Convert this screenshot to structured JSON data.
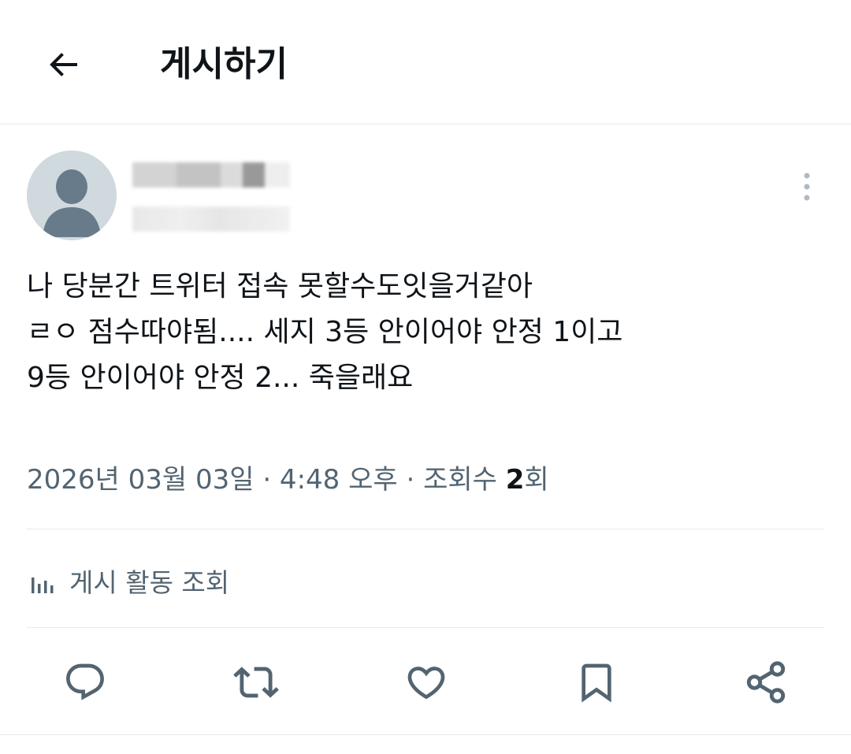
{
  "header": {
    "title": "게시하기",
    "back_icon": "back-arrow-icon"
  },
  "author": {
    "avatar_icon": "default-avatar-icon",
    "more_icon": "more-vertical-icon"
  },
  "tweet": {
    "lines": [
      "나 당분간 트위터 접속 못할수도잇을거같아",
      "ㄹㅇ 점수따야됨.... 세지 3등 안이어야 안정 1이고",
      "9등 안이어야 안정 2... 죽을래요"
    ]
  },
  "meta": {
    "datetime": "2026년 03월 03일 · 4:48 오후 · 조회수 ",
    "views": "2",
    "views_suffix": "회"
  },
  "activity": {
    "label": "게시 활동 조회",
    "icon": "analytics-bar-icon"
  },
  "actions": {
    "reply_icon": "reply-icon",
    "retweet_icon": "retweet-icon",
    "like_icon": "heart-icon",
    "bookmark_icon": "bookmark-icon",
    "share_icon": "share-icon"
  },
  "colors": {
    "text": "#0f1419",
    "secondary": "#536471",
    "divider": "#e7e9ea",
    "avatar_bg": "#cfd9de",
    "avatar_fg": "#687b8a"
  }
}
